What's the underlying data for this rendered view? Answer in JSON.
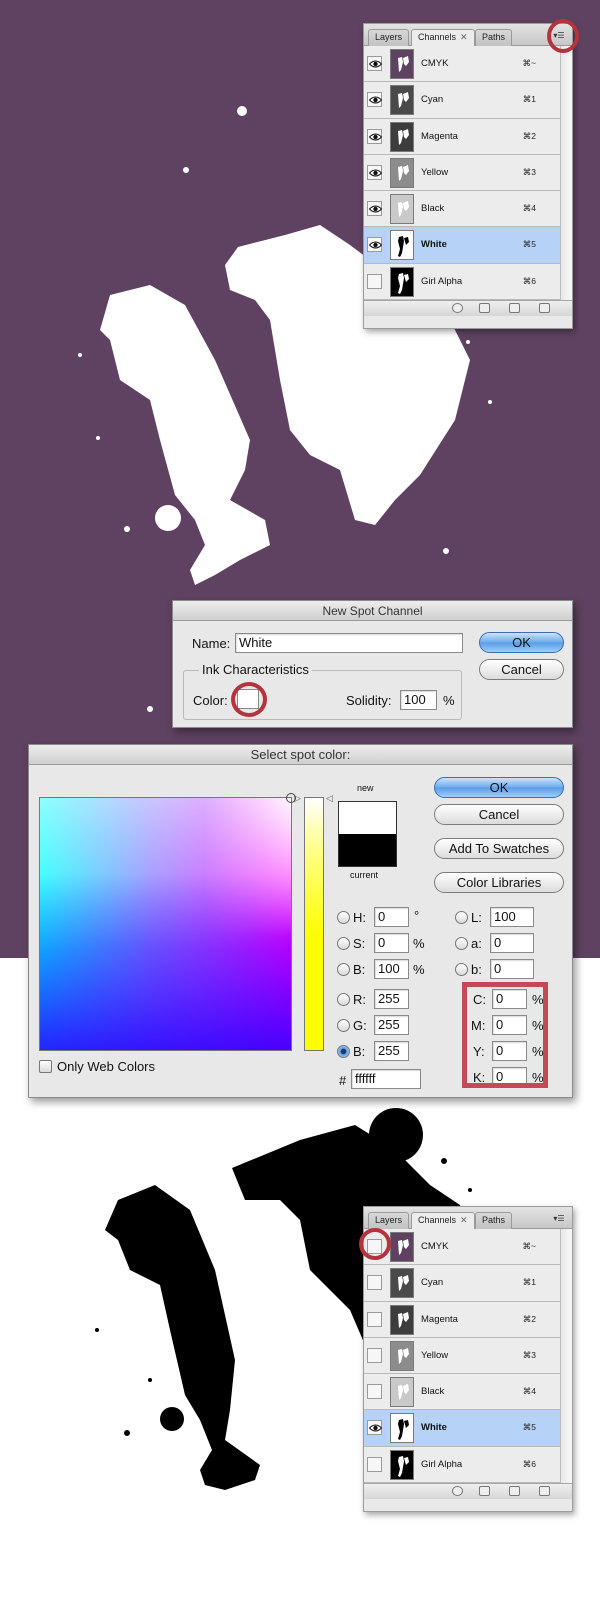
{
  "colors": {
    "background_purple": "#5f4261",
    "selection_blue": "#b7d2f7",
    "highlight_red": "#b5333c",
    "default_button_blue": "#5b9be6"
  },
  "panel": {
    "tabs": [
      "Layers",
      "Channels",
      "Paths"
    ],
    "channels": [
      {
        "name": "CMYK",
        "shortcut": "⌘~"
      },
      {
        "name": "Cyan",
        "shortcut": "⌘1"
      },
      {
        "name": "Magenta",
        "shortcut": "⌘2"
      },
      {
        "name": "Yellow",
        "shortcut": "⌘3"
      },
      {
        "name": "Black",
        "shortcut": "⌘4"
      },
      {
        "name": "White",
        "shortcut": "⌘5"
      },
      {
        "name": "Girl Alpha",
        "shortcut": "⌘6"
      }
    ],
    "selected_channel": "White",
    "visible_top": [
      "CMYK",
      "Cyan",
      "Magenta",
      "Yellow",
      "Black",
      "White"
    ],
    "visible_bottom": [
      "White"
    ]
  },
  "spot_dialog": {
    "title": "New Spot Channel",
    "name_label": "Name:",
    "name_value": "White",
    "group_title": "Ink Characteristics",
    "color_label": "Color:",
    "solidity_label": "Solidity:",
    "solidity_value": "100",
    "percent": "%",
    "ok": "OK",
    "cancel": "Cancel"
  },
  "picker": {
    "title": "Select spot color:",
    "new_label": "new",
    "current_label": "current",
    "ok": "OK",
    "cancel": "Cancel",
    "add_swatches": "Add To Swatches",
    "color_libraries": "Color Libraries",
    "hsb": [
      {
        "label": "H:",
        "value": "0",
        "unit": "°"
      },
      {
        "label": "S:",
        "value": "0",
        "unit": "%"
      },
      {
        "label": "B:",
        "value": "100",
        "unit": "%"
      }
    ],
    "rgb": [
      {
        "label": "R:",
        "value": "255"
      },
      {
        "label": "G:",
        "value": "255"
      },
      {
        "label": "B:",
        "value": "255"
      }
    ],
    "lab": [
      {
        "label": "L:",
        "value": "100"
      },
      {
        "label": "a:",
        "value": "0"
      },
      {
        "label": "b:",
        "value": "0"
      }
    ],
    "cmyk": [
      {
        "label": "C:",
        "value": "0"
      },
      {
        "label": "M:",
        "value": "0"
      },
      {
        "label": "Y:",
        "value": "0"
      },
      {
        "label": "K:",
        "value": "0"
      }
    ],
    "percent": "%",
    "hash": "#",
    "hex_value": "ffffff",
    "web_only_label": "Only Web Colors"
  }
}
